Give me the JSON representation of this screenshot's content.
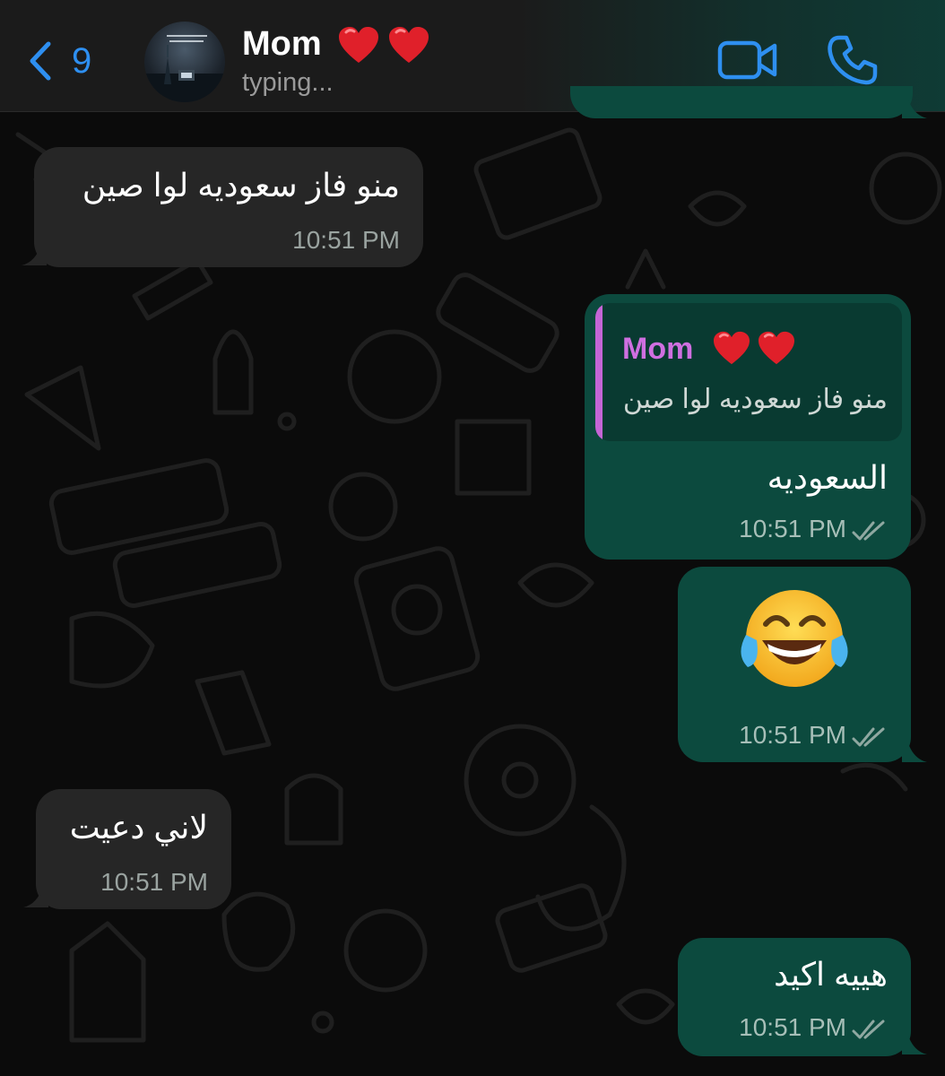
{
  "header": {
    "back_count": "9",
    "contact_name": "Mom",
    "status": "typing..."
  },
  "messages": [
    {
      "direction": "incoming",
      "text": "منو فاز سعوديه لوا صين",
      "time": "10:51 PM"
    },
    {
      "direction": "outgoing",
      "reply_to": {
        "name": "Mom",
        "text": "منو فاز سعوديه لوا صين"
      },
      "text": "السعوديه",
      "time": "10:51 PM",
      "read": true
    },
    {
      "direction": "outgoing",
      "emoji": "face-with-tears-of-joy",
      "time": "10:51 PM",
      "read": true
    },
    {
      "direction": "incoming",
      "text": "لاني دعيت",
      "time": "10:51 PM"
    },
    {
      "direction": "outgoing",
      "text": "هييه اكيد",
      "time": "10:51 PM",
      "read": true
    }
  ],
  "colors": {
    "accent": "#2e8ff0",
    "incoming_bubble": "#262626",
    "outgoing_bubble": "#0c4a3e",
    "quote_name": "#cf6fe0"
  },
  "icons": [
    "chevron-left-icon",
    "video-camera-icon",
    "phone-icon",
    "double-check-icon",
    "heart-icon"
  ]
}
